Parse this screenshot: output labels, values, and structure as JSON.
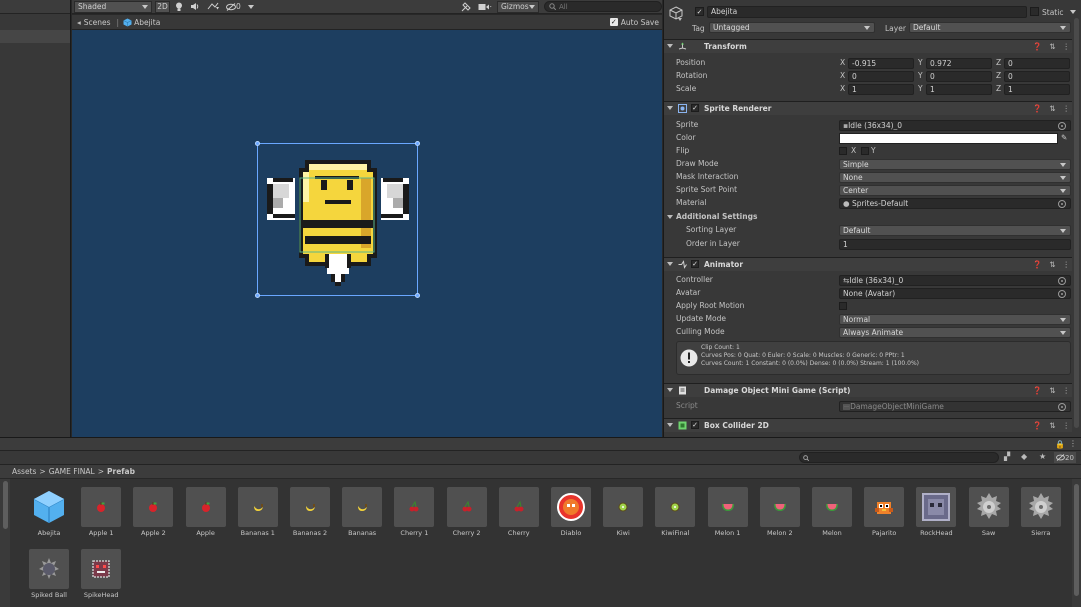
{
  "scene_toolbar": {
    "shading_mode": "Shaded",
    "mode_2d": "2D",
    "hidden_count": "0",
    "gizmos": "Gizmos",
    "search_placeholder": "All"
  },
  "scene_tabs": {
    "scenes": "Scenes",
    "object": "Abejita",
    "auto_save": "Auto Save"
  },
  "inspector": {
    "object_name": "Abejita",
    "static_label": "Static",
    "tag_label": "Tag",
    "tag_value": "Untagged",
    "layer_label": "Layer",
    "layer_value": "Default",
    "transform": {
      "title": "Transform",
      "position_label": "Position",
      "position": {
        "x": "-0.915",
        "y": "0.972",
        "z": "0"
      },
      "rotation_label": "Rotation",
      "rotation": {
        "x": "0",
        "y": "0",
        "z": "0"
      },
      "scale_label": "Scale",
      "scale": {
        "x": "1",
        "y": "1",
        "z": "1"
      },
      "axis_x": "X",
      "axis_y": "Y",
      "axis_z": "Z"
    },
    "sprite_renderer": {
      "title": "Sprite Renderer",
      "sprite_label": "Sprite",
      "sprite_value": "Idle (36x34)_0",
      "color_label": "Color",
      "color_value": "#ffffff",
      "flip_label": "Flip",
      "flip_x": "X",
      "flip_y": "Y",
      "draw_mode_label": "Draw Mode",
      "draw_mode_value": "Simple",
      "mask_label": "Mask Interaction",
      "mask_value": "None",
      "sort_point_label": "Sprite Sort Point",
      "sort_point_value": "Center",
      "material_label": "Material",
      "material_value": "Sprites-Default",
      "additional_label": "Additional Settings",
      "sorting_layer_label": "Sorting Layer",
      "sorting_layer_value": "Default",
      "order_label": "Order in Layer",
      "order_value": "1"
    },
    "animator": {
      "title": "Animator",
      "controller_label": "Controller",
      "controller_value": "Idle (36x34)_0",
      "avatar_label": "Avatar",
      "avatar_value": "None (Avatar)",
      "root_motion_label": "Apply Root Motion",
      "update_label": "Update Mode",
      "update_value": "Normal",
      "culling_label": "Culling Mode",
      "culling_value": "Always Animate",
      "info_line1": "Clip Count: 1",
      "info_line2": "Curves Pos: 0 Quat: 0 Euler: 0 Scale: 0 Muscles: 0 Generic: 0 PPtr: 1",
      "info_line3": "Curves Count: 1 Constant: 0 (0.0%) Dense: 0 (0.0%) Stream: 1 (100.0%)"
    },
    "damage_script": {
      "title": "Damage Object Mini Game (Script)",
      "script_label": "Script",
      "script_value": "DamageObjectMiniGame"
    },
    "box_collider": {
      "title": "Box Collider 2D"
    }
  },
  "project": {
    "hidden_count": "20",
    "breadcrumb": [
      "Assets",
      "GAME FINAL",
      "Prefab"
    ],
    "assets": [
      {
        "name": "Abejita",
        "icon": "prefab-cube-icon"
      },
      {
        "name": "Apple 1",
        "icon": "apple-icon"
      },
      {
        "name": "Apple 2",
        "icon": "apple-icon"
      },
      {
        "name": "Apple",
        "icon": "apple-icon"
      },
      {
        "name": "Bananas 1",
        "icon": "banana-icon"
      },
      {
        "name": "Bananas 2",
        "icon": "banana-icon"
      },
      {
        "name": "Bananas",
        "icon": "banana-icon"
      },
      {
        "name": "Cherry 1",
        "icon": "cherry-icon"
      },
      {
        "name": "Cherry 2",
        "icon": "cherry-icon"
      },
      {
        "name": "Cherry",
        "icon": "cherry-icon"
      },
      {
        "name": "Diablo",
        "icon": "diablo-icon"
      },
      {
        "name": "Kiwi",
        "icon": "kiwi-icon"
      },
      {
        "name": "KiwiFinal",
        "icon": "kiwi-icon"
      },
      {
        "name": "Melon 1",
        "icon": "melon-icon"
      },
      {
        "name": "Melon 2",
        "icon": "melon-icon"
      },
      {
        "name": "Melon",
        "icon": "melon-icon"
      },
      {
        "name": "Pajarito",
        "icon": "bird-icon"
      },
      {
        "name": "RockHead",
        "icon": "rockhead-icon"
      },
      {
        "name": "Saw",
        "icon": "saw-icon"
      },
      {
        "name": "Sierra",
        "icon": "saw-icon"
      },
      {
        "name": "Spiked Ball",
        "icon": "spiked-ball-icon"
      },
      {
        "name": "SpikeHead",
        "icon": "spikehead-icon"
      }
    ]
  },
  "colors": {
    "scene_bg": "#1d3e60",
    "selection": "#6aa7ff"
  }
}
